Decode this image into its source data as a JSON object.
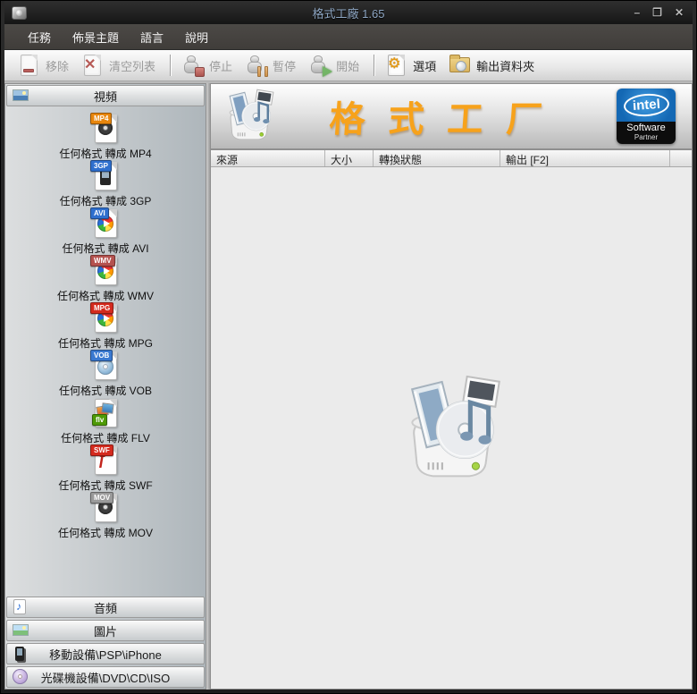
{
  "window": {
    "title": "格式工廠 1.65",
    "controls": {
      "minimize": "–",
      "maximize": "❒",
      "close": "✕"
    }
  },
  "menu": {
    "items": [
      {
        "label": "任務"
      },
      {
        "label": "佈景主題"
      },
      {
        "label": "語言"
      },
      {
        "label": "說明"
      }
    ]
  },
  "toolbar": {
    "buttons": [
      {
        "label": "移除",
        "icon": "remove-icon",
        "enabled": false
      },
      {
        "label": "清空列表",
        "icon": "clear-list-icon",
        "enabled": false
      },
      {
        "label": "停止",
        "icon": "stop-icon",
        "enabled": false
      },
      {
        "label": "暫停",
        "icon": "pause-icon",
        "enabled": false
      },
      {
        "label": "開始",
        "icon": "start-icon",
        "enabled": false
      },
      {
        "label": "選項",
        "icon": "options-icon",
        "enabled": true
      },
      {
        "label": "輸出資料夾",
        "icon": "output-folder-icon",
        "enabled": true
      }
    ]
  },
  "sidebar": {
    "video_header": "視頻",
    "video_items": [
      {
        "label": "任何格式 轉成 MP4",
        "badge": "MP4",
        "badge_color": "#e8860d",
        "glyph": "film-reel"
      },
      {
        "label": "任何格式 轉成 3GP",
        "badge": "3GP",
        "badge_color": "#2e6fce",
        "glyph": "mobile-phone"
      },
      {
        "label": "任何格式 轉成 AVI",
        "badge": "AVI",
        "badge_color": "#2e6fce",
        "glyph": "play-circle"
      },
      {
        "label": "任何格式 轉成 WMV",
        "badge": "WMV",
        "badge_color": "#b5524f",
        "glyph": "play-circle"
      },
      {
        "label": "任何格式 轉成 MPG",
        "badge": "MPG",
        "badge_color": "#d42a1e",
        "glyph": "play-circle"
      },
      {
        "label": "任何格式 轉成 VOB",
        "badge": "VOB",
        "badge_color": "#3a79d0",
        "glyph": "disc"
      },
      {
        "label": "任何格式 轉成 FLV",
        "badge": "flv",
        "badge_color": "#4e9a06",
        "glyph": "photos"
      },
      {
        "label": "任何格式 轉成 SWF",
        "badge": "SWF",
        "badge_color": "#d42a1e",
        "glyph": "flash-f"
      },
      {
        "label": "任何格式 轉成 MOV",
        "badge": "MOV",
        "badge_color": "#9a9a9a",
        "glyph": "film-reel"
      }
    ],
    "categories": [
      {
        "label": "音頻",
        "icon": "audio-icon"
      },
      {
        "label": "圖片",
        "icon": "picture-icon"
      },
      {
        "label": "移動設備\\PSP\\iPhone",
        "icon": "mobile-device-icon"
      },
      {
        "label": "光碟機設備\\DVD\\CD\\ISO",
        "icon": "optical-disc-icon"
      }
    ]
  },
  "banner": {
    "title": "格式工厂",
    "accent_color": "#f7a21b",
    "intel_badge": {
      "brand": "intel",
      "line1": "Software",
      "line2": "Partner"
    }
  },
  "table": {
    "columns": [
      {
        "label": "來源"
      },
      {
        "label": "大小"
      },
      {
        "label": "轉換狀態"
      },
      {
        "label": "輸出 [F2]"
      }
    ],
    "rows": []
  }
}
